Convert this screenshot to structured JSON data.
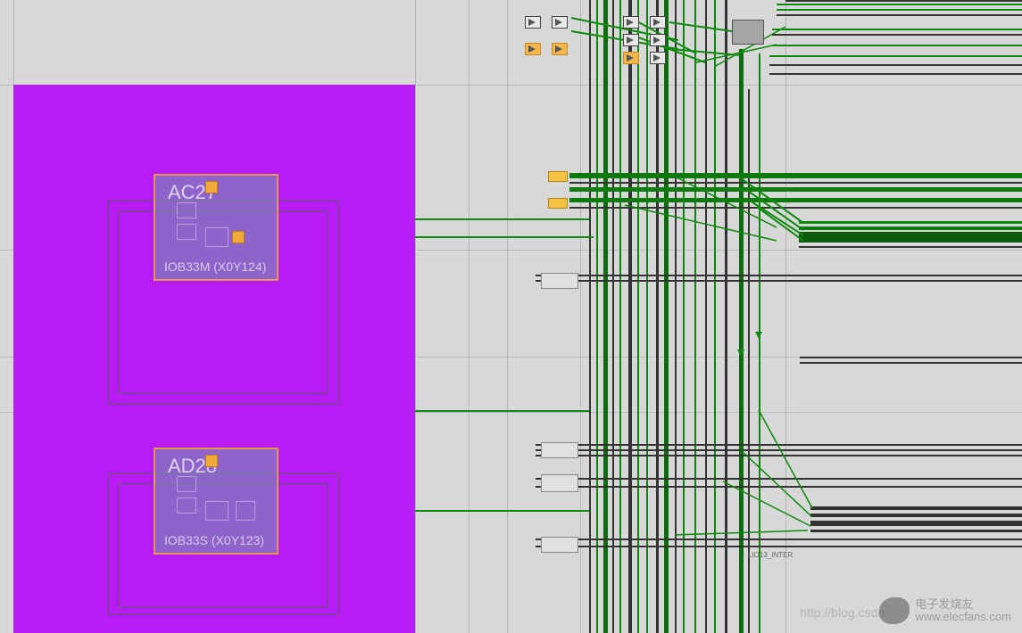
{
  "tiles": {
    "tile1": {
      "pin": "AC27",
      "site": "IOB33M (X0Y124)"
    },
    "tile2": {
      "pin": "AD28",
      "site": "IOB33S (X0Y123)"
    }
  },
  "labels": {
    "interconnect": "LIO13_INTER"
  },
  "watermark": {
    "brand_line1": "电子发烧友",
    "brand_line2": "www.elecfans.com",
    "url": "http://blog.csdn."
  }
}
